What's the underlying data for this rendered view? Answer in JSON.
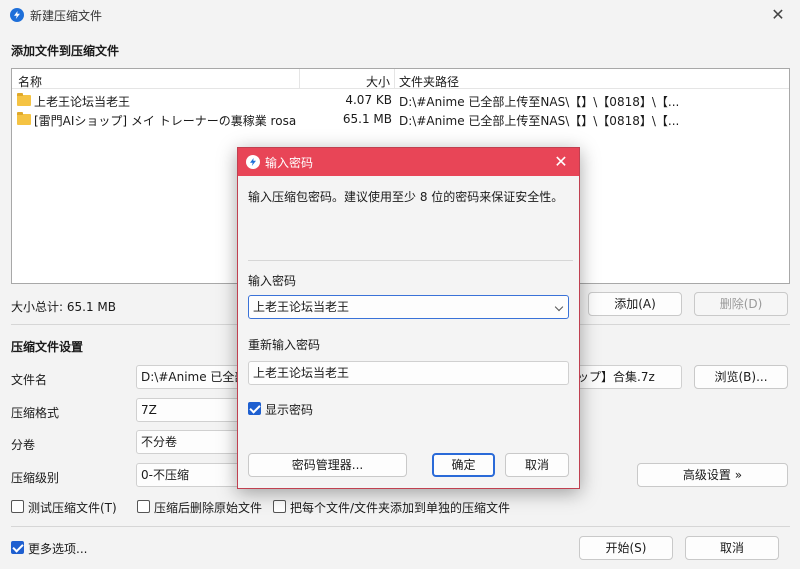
{
  "window": {
    "title": "新建压缩文件",
    "close": "✕"
  },
  "add_section": {
    "heading": "添加文件到压缩文件",
    "columns": {
      "name": "名称",
      "size": "大小",
      "path": "文件夹路径"
    },
    "rows": [
      {
        "name": "上老王论坛当老王",
        "size": "4.07 KB",
        "path": "D:\\#Anime 已全部上传至NAS\\【】\\【0818】\\【..."
      },
      {
        "name": "[雷門AIショップ] メイ トレーナーの裏稼業 rosa (...",
        "size": "65.1 MB",
        "path": "D:\\#Anime 已全部上传至NAS\\【】\\【0818】\\【..."
      }
    ],
    "total": "大小总计: 65.1 MB",
    "add_btn": "添加(A)",
    "delete_btn": "删除(D)"
  },
  "settings": {
    "heading": "压缩文件设置",
    "filename_label": "文件名",
    "filename_value": "D:\\#Anime 已全部",
    "filename_tail": "ップ】合集.7z",
    "browse_btn": "浏览(B)...",
    "format_label": "压缩格式",
    "format_value": "7Z",
    "split_label": "分卷",
    "split_value": "不分卷",
    "level_label": "压缩级别",
    "level_value": "0-不压缩",
    "advanced_btn": "高级设置 »",
    "opt_test": "测试压缩文件(T)",
    "opt_delete": "压缩后删除原始文件",
    "opt_each": "把每个文件/文件夹添加到单独的压缩文件",
    "more_options": "更多选项...",
    "start_btn": "开始(S)",
    "cancel_btn": "取消"
  },
  "dialog": {
    "title": "输入密码",
    "close": "✕",
    "hint": "输入压缩包密码。建议使用至少 8 位的密码来保证安全性。",
    "pwd_label": "输入密码",
    "pwd_value": "上老王论坛当老王",
    "repwd_label": "重新输入密码",
    "repwd_value": "上老王论坛当老王",
    "show_pwd": "显示密码",
    "manager_btn": "密码管理器...",
    "ok_btn": "确定",
    "cancel_btn": "取消"
  }
}
